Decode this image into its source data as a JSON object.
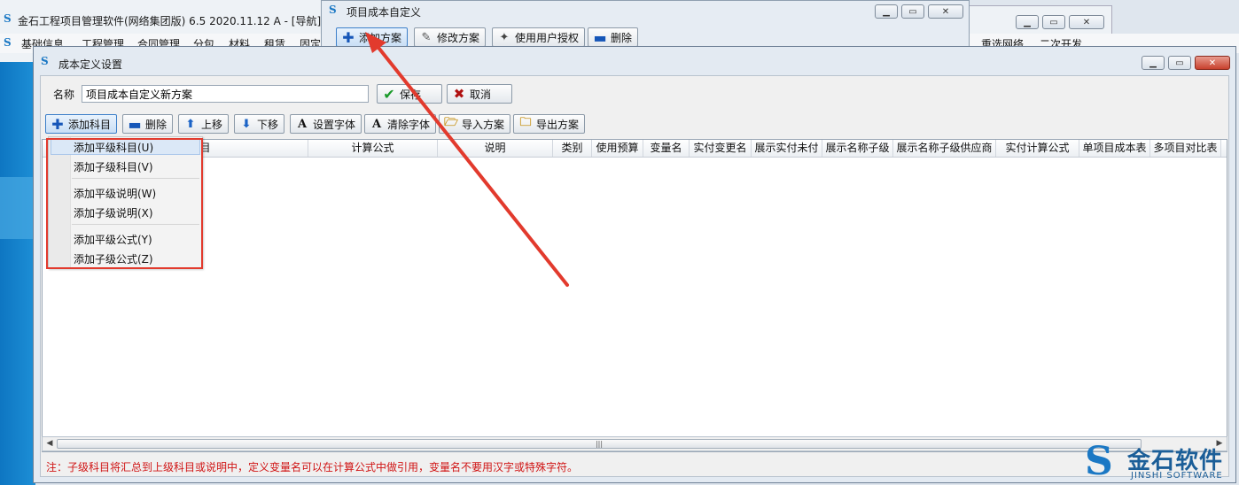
{
  "background": {
    "main_app": {
      "title": "金石工程项目管理软件(网络集团版) 6.5   2020.11.12 A - [导航]",
      "menu": [
        "基础信息",
        "工程管理",
        "合同管理",
        "分包",
        "材料",
        "租赁",
        "固定"
      ]
    },
    "right_menu": [
      "重选网络",
      "二次开发"
    ]
  },
  "project_window": {
    "title": "项目成本自定义",
    "toolbar": {
      "add": "添加方案",
      "edit": "修改方案",
      "auth": "使用用户授权",
      "delete": "删除"
    }
  },
  "cost_window": {
    "title": "成本定义设置",
    "name_label": "名称",
    "name_value": "项目成本自定义新方案",
    "save": "保存",
    "cancel": "取消",
    "toolbar": {
      "add_subject": "添加科目",
      "delete": "删除",
      "move_up": "上移",
      "move_down": "下移",
      "set_font": "设置字体",
      "clear_font": "清除字体",
      "import": "导入方案",
      "export": "导出方案"
    },
    "columns": [
      "显示科目",
      "计算公式",
      "说明",
      "类别",
      "使用预算",
      "变量名",
      "实付变更名",
      "展示实付未付",
      "展示名称子级",
      "展示名称子级供应商",
      "实付计算公式",
      "单项目成本表",
      "多项目对比表"
    ],
    "dropdown": [
      "添加平级科目(U)",
      "添加子级科目(V)",
      "添加平级说明(W)",
      "添加子级说明(X)",
      "添加平级公式(Y)",
      "添加子级公式(Z)"
    ],
    "note": "注：子级科目将汇总到上级科目或说明中，定义变量名可以在计算公式中做引用，变量名不要用汉字或特殊字符。"
  },
  "logo": {
    "cn": "金石软件",
    "en": "JINSHI SOFTWARE"
  },
  "colors": {
    "annotation_red": "#e23a2d",
    "note_red": "#d01414",
    "accent_blue": "#1656b8"
  }
}
